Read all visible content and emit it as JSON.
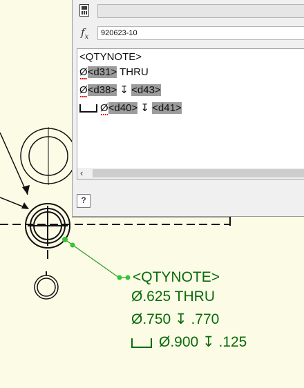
{
  "formula_bar": {
    "name_value": "920623-10"
  },
  "editor": {
    "lines": [
      [
        "<QTYNOTE>"
      ],
      [
        "Ø",
        "<d31>",
        " THRU"
      ],
      [
        "Ø",
        "<d38>",
        " ↧ ",
        "<d43>"
      ],
      [
        "Ø",
        "<d40>",
        " ↧ ",
        "<d41>"
      ]
    ]
  },
  "drawing_note": {
    "line1": "<QTYNOTE>",
    "line2": "Ø.625 THRU",
    "line3": "Ø.750 ↧ .770",
    "line4": "Ø.900 ↧ .125"
  },
  "icons": [
    "calculator-icon",
    "fx-icon",
    "scroll-left-icon",
    "help-icon"
  ],
  "colors": {
    "note_green": "#0a6b0a",
    "leader_green": "#2a9a2a",
    "dot_green": "#35c535",
    "highlight": "#9c9c9c"
  }
}
